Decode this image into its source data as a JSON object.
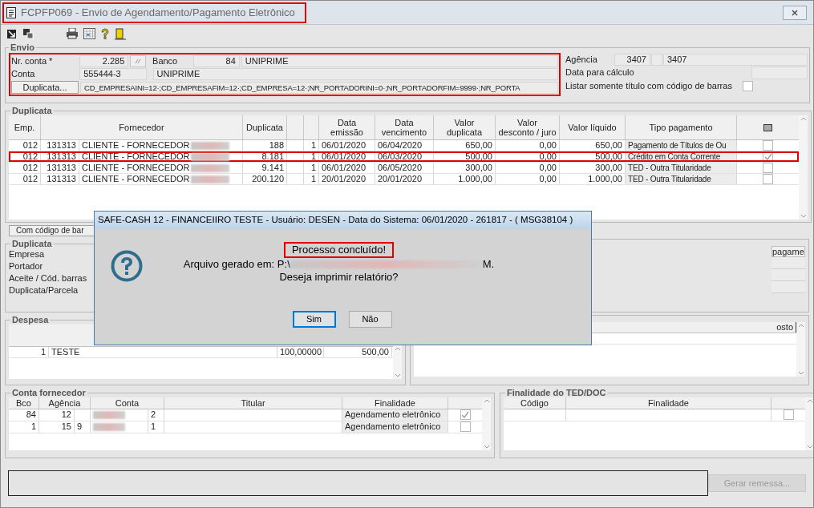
{
  "window": {
    "title": "FCPFP069 - Envio de Agendamento/Pagamento Eletrônico",
    "highlighted": true
  },
  "envio": {
    "legend": "Envio",
    "highlighted": true,
    "nr_conta_label": "Nr. conta *",
    "nr_conta": "2.285",
    "banco_label": "Banco",
    "banco_code": "84",
    "banco_name": "UNIPRIME",
    "conta_label": "Conta",
    "conta": "555444-3",
    "conta_name": "UNIPRIME",
    "duplicata_button": "Duplicata...",
    "filter": "CD_EMPRESAINI=12·;CD_EMPRESAFIM=12·;CD_EMPRESA=12·;NR_PORTADORINI=0·;NR_PORTADORFIM=9999·;NR_PORTA",
    "agencia_label": "Agência",
    "agencia_code": "3407",
    "agencia_name": "3407",
    "data_calculo_label": "Data para cálculo",
    "barcode_only_label": "Listar somente título com código de barras",
    "barcode_only_checked": false
  },
  "duplicata": {
    "legend": "Duplicata",
    "columns": [
      "Emp.",
      "Fornecedor",
      "Duplicata",
      "",
      "",
      "Data\nemissão",
      "Data\nvencimento",
      "Valor\nduplicata",
      "Valor\ndesconto / juro",
      "Valor líquido",
      "Tipo pagamento"
    ],
    "rows": [
      {
        "emp": "012",
        "code": "131313",
        "fornecedor": "CLIENTE - FORNECEDOR",
        "duplicata": "188",
        "parcela": "1",
        "emissao": "06/01/2020",
        "vencimento": "06/04/2020",
        "valor": "650,00",
        "desconto": "0,00",
        "liquido": "650,00",
        "tipo": "Pagamento de Títulos de Ou",
        "checked": false,
        "highlighted": false
      },
      {
        "emp": "012",
        "code": "131313",
        "fornecedor": "CLIENTE - FORNECEDOR",
        "duplicata": "8.181",
        "parcela": "1",
        "emissao": "06/01/2020",
        "vencimento": "06/03/2020",
        "valor": "500,00",
        "desconto": "0,00",
        "liquido": "500,00",
        "tipo": "Crédito em Conta Corrente",
        "checked": true,
        "highlighted": true
      },
      {
        "emp": "012",
        "code": "131313",
        "fornecedor": "CLIENTE - FORNECEDOR",
        "duplicata": "9.141",
        "parcela": "1",
        "emissao": "06/01/2020",
        "vencimento": "06/05/2020",
        "valor": "300,00",
        "desconto": "0,00",
        "liquido": "300,00",
        "tipo": "TED - Outra Titularidade",
        "checked": false,
        "highlighted": false
      },
      {
        "emp": "012",
        "code": "131313",
        "fornecedor": "CLIENTE - FORNECEDOR",
        "duplicata": "200.120",
        "parcela": "1",
        "emissao": "20/01/2020",
        "vencimento": "20/01/2020",
        "valor": "1.000,00",
        "desconto": "0,00",
        "liquido": "1.000,00",
        "tipo": "TED - Outra Titularidade",
        "checked": false,
        "highlighted": false
      }
    ]
  },
  "barcode_button": "Com código de bar",
  "detail": {
    "legend": "Duplicata",
    "labels": [
      "Empresa",
      "Portador",
      "Aceite / Cód. barras",
      "Duplicata/Parcela"
    ],
    "right_header": "pagame"
  },
  "despesa": {
    "legend": "Despesa",
    "rows": [
      {
        "seq": "1",
        "name": "TESTE",
        "rate": "100,00000",
        "value": "500,00"
      }
    ],
    "right_header": "osto"
  },
  "conta_fornecedor": {
    "legend": "Conta fornecedor",
    "columns": [
      "Bco",
      "Agência",
      "Conta",
      "Titular",
      "Finalidade"
    ],
    "rows": [
      {
        "bco": "84",
        "agencia": "12",
        "agencia_dv": "",
        "conta_dv": "2",
        "finalidade": "Agendamento eletrônico",
        "checked": true
      },
      {
        "bco": "1",
        "agencia": "15",
        "agencia_dv": "9",
        "conta_dv": "1",
        "finalidade": "Agendamento eletrônico",
        "checked": false
      }
    ]
  },
  "finalidade_ted": {
    "legend": "Finalidade do TED/DOC",
    "columns": [
      "Código",
      "Finalidade"
    ],
    "checked": false
  },
  "gerar_button": {
    "label": "Gerar remessa...",
    "disabled": true
  },
  "dialog": {
    "title": "SAFE-CASH 12 - FINANCEIIRO TESTE - Usuário: DESEN - Data do Sistema: 06/01/2020 - 261817 - ( MSG38104 )",
    "message": "Processo concluído!",
    "message_highlighted": true,
    "file_prefix": "Arquivo gerado em: P:\\",
    "file_suffix": "M.",
    "question": "Deseja imprimir relatório?",
    "buttons": [
      {
        "label": "Sim",
        "selected": true
      },
      {
        "label": "Não",
        "selected": false
      }
    ]
  }
}
